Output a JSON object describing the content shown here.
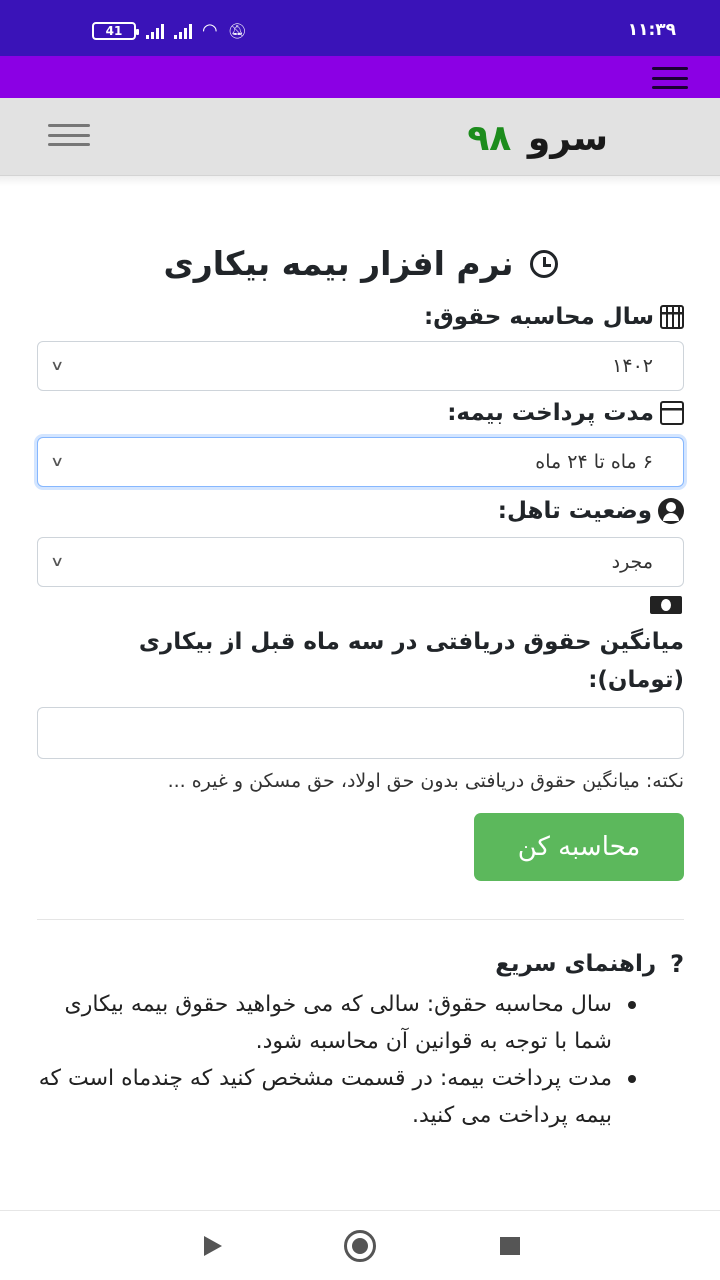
{
  "status_bar": {
    "time": "۱۱:۳۹",
    "battery": "41",
    "icons": [
      "signal-icon",
      "signal-icon",
      "wifi-icon",
      "mute-icon"
    ]
  },
  "app_bar": {
    "menu_icon": "hamburger-menu-icon",
    "color": "#8b00e4"
  },
  "site_header": {
    "logo_text": "سرو",
    "logo_number": "۹۸",
    "logo_number_color": "#1c8c1c",
    "menu_icon": "hamburger-menu-icon"
  },
  "main": {
    "title": "نرم افزار بیمه بیکاری",
    "year_field": {
      "label": "سال محاسبه حقوق:",
      "value": "۱۴۰۲"
    },
    "duration_field": {
      "label": "مدت پرداخت بیمه:",
      "value": "۶ ماه تا ۲۴ ماه"
    },
    "marital_field": {
      "label": "وضعیت تاهل:",
      "value": "مجرد"
    },
    "salary_field": {
      "label": "میانگین حقوق دریافتی در سه ماه قبل از بیکاری (تومان):",
      "value": "",
      "note": "نکته: میانگین حقوق دریافتی بدون حق اولاد، حق مسکن و غیره ..."
    },
    "calculate_button": "محاسبه کن",
    "button_color": "#5cb85c"
  },
  "guide": {
    "title": "راهنمای سریع",
    "items": [
      "سال محاسبه حقوق: سالی که می خواهید حقوق بیمه بیکاری شما با توجه به قوانین آن محاسبه شود.",
      "مدت پرداخت بیمه: در قسمت مشخص کنید که چندماه است که بیمه پرداخت می کنید."
    ]
  },
  "nav_bar": {
    "buttons": [
      "back-icon",
      "home-icon",
      "recent-apps-icon"
    ]
  }
}
